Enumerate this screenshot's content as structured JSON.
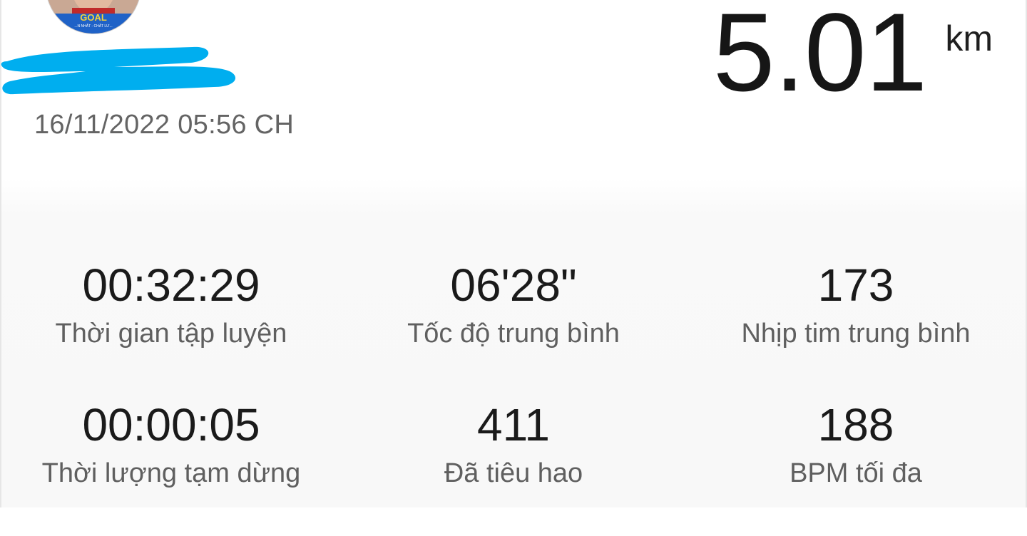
{
  "workout": {
    "avatar_text": "GOAL",
    "avatar_subtext": "...N NHẤT - CHẤT LƯ...",
    "date_time": "16/11/2022 05:56 CH",
    "distance": {
      "value": "5.01",
      "unit": "km"
    },
    "stats": [
      {
        "value": "00:32:29",
        "label": "Thời gian tập luyện"
      },
      {
        "value": "06'28\"",
        "label": "Tốc độ trung bình"
      },
      {
        "value": "173",
        "label": "Nhịp tim trung bình"
      },
      {
        "value": "00:00:05",
        "label": "Thời lượng tạm dừng"
      },
      {
        "value": "411",
        "label": "Đã tiêu hao"
      },
      {
        "value": "188",
        "label": "BPM tối đa"
      }
    ]
  },
  "colors": {
    "redaction": "#00aeef",
    "value_text": "#1a1a1a",
    "label_text": "#5f5f5f"
  }
}
